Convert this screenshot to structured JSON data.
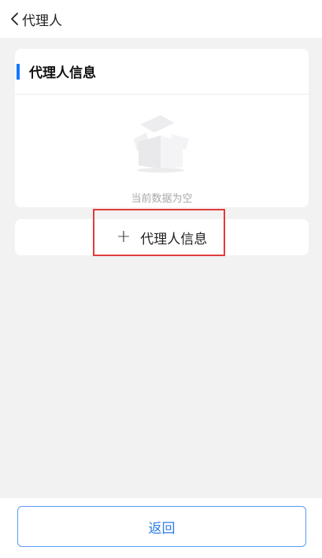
{
  "nav": {
    "back_icon": "chevron-left-icon",
    "title": "代理人"
  },
  "info_card": {
    "title": "代理人信息",
    "accent_color": "#1677ff",
    "empty_icon": "empty-box-icon",
    "empty_text": "当前数据为空"
  },
  "add_action": {
    "icon": "plus-icon",
    "plus_glyph": "+",
    "label": "代理人信息",
    "highlight_color": "#e23b3b"
  },
  "footer": {
    "return_label": "返回",
    "accent_color": "#2f7be5"
  }
}
